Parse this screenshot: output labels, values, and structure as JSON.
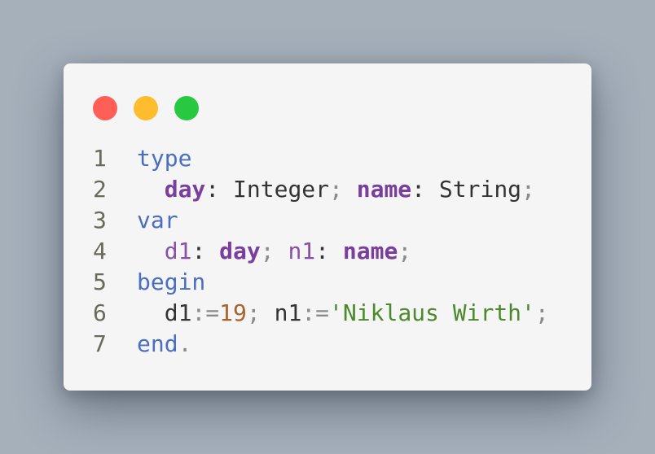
{
  "window": {
    "controls": [
      {
        "name": "close",
        "color": "#ff5f57"
      },
      {
        "name": "minimize",
        "color": "#ffbd2e"
      },
      {
        "name": "maximize",
        "color": "#28c941"
      }
    ]
  },
  "code": {
    "language": "Pascal",
    "lines": [
      {
        "num": "1",
        "tokens": [
          {
            "t": "type",
            "k": "kw"
          }
        ]
      },
      {
        "num": "2",
        "tokens": [
          {
            "t": "  ",
            "k": "plain"
          },
          {
            "t": "day",
            "k": "type"
          },
          {
            "t": ": Integer",
            "k": "plain"
          },
          {
            "t": ";",
            "k": "punct"
          },
          {
            "t": " ",
            "k": "plain"
          },
          {
            "t": "name",
            "k": "type"
          },
          {
            "t": ": String",
            "k": "plain"
          },
          {
            "t": ";",
            "k": "punct"
          }
        ]
      },
      {
        "num": "3",
        "tokens": [
          {
            "t": "var",
            "k": "kw"
          }
        ]
      },
      {
        "num": "4",
        "tokens": [
          {
            "t": "  ",
            "k": "plain"
          },
          {
            "t": "d1",
            "k": "var"
          },
          {
            "t": ": ",
            "k": "plain"
          },
          {
            "t": "day",
            "k": "type"
          },
          {
            "t": ";",
            "k": "punct"
          },
          {
            "t": " ",
            "k": "plain"
          },
          {
            "t": "n1",
            "k": "var"
          },
          {
            "t": ": ",
            "k": "plain"
          },
          {
            "t": "name",
            "k": "type"
          },
          {
            "t": ";",
            "k": "punct"
          }
        ]
      },
      {
        "num": "5",
        "tokens": [
          {
            "t": "begin",
            "k": "kw"
          }
        ]
      },
      {
        "num": "6",
        "tokens": [
          {
            "t": "  d1",
            "k": "plain"
          },
          {
            "t": ":=",
            "k": "punct"
          },
          {
            "t": "19",
            "k": "num"
          },
          {
            "t": ";",
            "k": "punct"
          },
          {
            "t": " n1",
            "k": "plain"
          },
          {
            "t": ":=",
            "k": "punct"
          },
          {
            "t": "'Niklaus Wirth'",
            "k": "str"
          },
          {
            "t": ";",
            "k": "punct"
          }
        ]
      },
      {
        "num": "7",
        "tokens": [
          {
            "t": "end",
            "k": "kw"
          },
          {
            "t": ".",
            "k": "punct"
          }
        ]
      }
    ]
  }
}
